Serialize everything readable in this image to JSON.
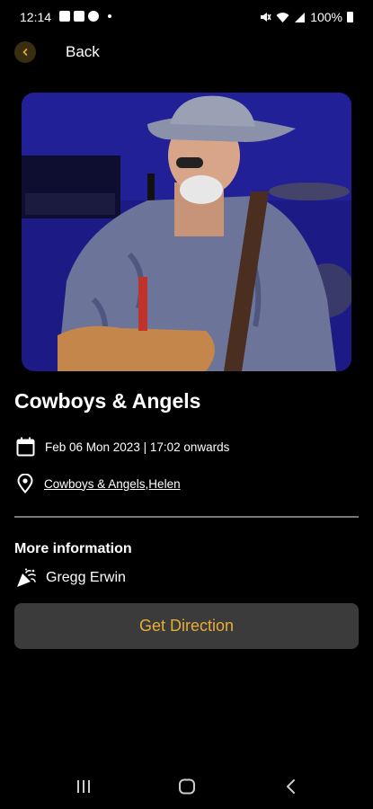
{
  "status_bar": {
    "time": "12:14",
    "battery_text": "100%",
    "left_icons": [
      "gallery-icon",
      "check-icon",
      "cloud-icon"
    ],
    "right_icons": [
      "mute-icon",
      "wifi-icon",
      "signal-icon",
      "battery-icon"
    ]
  },
  "header": {
    "back_label": "Back"
  },
  "event": {
    "hero_image": "concert-photo",
    "title": "Cowboys & Angels",
    "date_text": "Feb 06 Mon 2023 | 17:02 onwards",
    "location_text": "Cowboys & Angels,Helen",
    "more_info_title": "More information",
    "artist": "Gregg Erwin"
  },
  "actions": {
    "direction_label": "Get Direction"
  },
  "colors": {
    "accent": "#e8ad38",
    "background": "#000000",
    "button_bg": "#3b3b3b",
    "divider": "#777777"
  },
  "nav_bar": {
    "buttons": [
      "recents-icon",
      "home-icon",
      "back-nav-icon"
    ]
  }
}
